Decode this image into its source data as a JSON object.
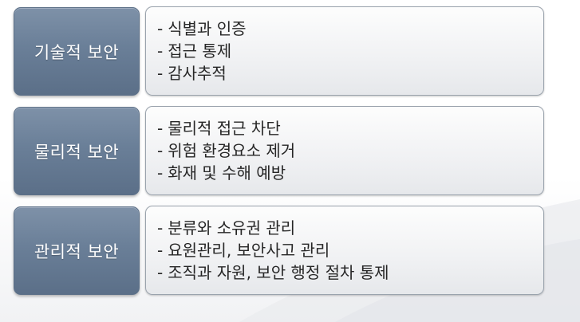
{
  "rows": [
    {
      "label": "기술적 보안",
      "items": [
        "식별과 인증",
        "접근 통제",
        "감사추적"
      ]
    },
    {
      "label": "물리적 보안",
      "items": [
        "물리적 접근 차단",
        "위험 환경요소 제거",
        "화재 및 수해 예방"
      ]
    },
    {
      "label": "관리적 보안",
      "items": [
        "분류와 소유권 관리",
        "요원관리, 보안사고 관리",
        "조직과 자원, 보안 행정 절차 통제"
      ]
    }
  ],
  "bullet": "-",
  "colors": {
    "label_box": "#6a7f98",
    "label_border": "#5c7088",
    "content_border": "#9aa3ad",
    "text": "#262626"
  }
}
